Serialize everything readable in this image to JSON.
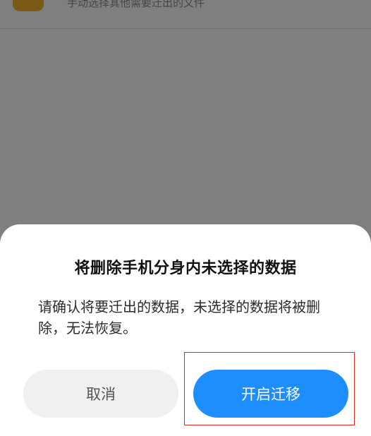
{
  "background": {
    "item_subtitle": "手动选择其他需要迁出的文件"
  },
  "dialog": {
    "title": "将删除手机分身内未选择的数据",
    "message": "请确认将要迁出的数据，未选择的数据将被删除，无法恢复。",
    "cancel_label": "取消",
    "confirm_label": "开启迁移"
  },
  "colors": {
    "primary": "#1e8eff",
    "highlight": "#e0281e",
    "folder_icon": "#f6b52c"
  }
}
